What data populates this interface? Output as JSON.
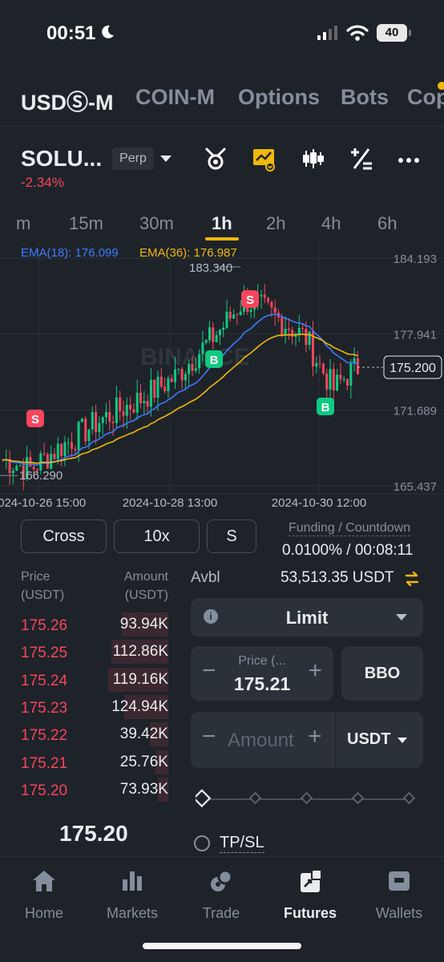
{
  "status_bar": {
    "time": "00:51",
    "battery": "40"
  },
  "market_tabs": [
    "USDⓈ-M",
    "COIN-M",
    "Options",
    "Bots",
    "Cop"
  ],
  "header": {
    "symbol": "SOLU...",
    "contract": "Perp",
    "change": "-2.34%"
  },
  "header_icons": [
    "bot-icon",
    "chart-toggle-icon",
    "candlestick-icon",
    "calculator-icon",
    "more-icon"
  ],
  "intervals": [
    "m",
    "15m",
    "30m",
    "1h",
    "2h",
    "4h",
    "6h"
  ],
  "active_interval": "1h",
  "chart_data": {
    "type": "candlestick",
    "watermark": "BINANCE",
    "indicators": [
      {
        "label": "EMA(18): 176.099",
        "color": "#3d7bfd"
      },
      {
        "label": "EMA(36): 176.987",
        "color": "#f0b90b"
      }
    ],
    "y_ticks": [
      "184.193",
      "177.941",
      "171.689",
      "165.437"
    ],
    "x_ticks": [
      "2024-10-26 15:00",
      "2024-10-28 13:00",
      "2024-10-30 12:00"
    ],
    "ylim": [
      165.437,
      184.193
    ],
    "high_label": "183.340",
    "low_label": "166.290",
    "current_price": "175.200",
    "markers": [
      {
        "label": "S",
        "side": "sell"
      },
      {
        "label": "S",
        "side": "sell"
      },
      {
        "label": "B",
        "side": "buy"
      },
      {
        "label": "B",
        "side": "buy"
      }
    ]
  },
  "controls": {
    "margin_mode": "Cross",
    "leverage": "10x",
    "asset_mode": "S",
    "funding_label": "Funding / Countdown",
    "funding_value": "0.0100% / 00:08:11"
  },
  "order_book": {
    "price_header": "Price\n(USDT)",
    "amount_header": "Amount\n(USDT)",
    "asks": [
      {
        "price": "175.26",
        "amount": "93.94K",
        "depth": 0.45
      },
      {
        "price": "175.25",
        "amount": "112.86K",
        "depth": 0.55
      },
      {
        "price": "175.24",
        "amount": "119.16K",
        "depth": 0.58
      },
      {
        "price": "175.23",
        "amount": "124.94K",
        "depth": 0.42
      },
      {
        "price": "175.22",
        "amount": "39.42K",
        "depth": 0.18
      },
      {
        "price": "175.21",
        "amount": "25.76K",
        "depth": 0.12
      },
      {
        "price": "175.20",
        "amount": "73.93K",
        "depth": 0.1
      }
    ],
    "last_price": "175.20"
  },
  "order_form": {
    "avbl_label": "Avbl",
    "avbl_value": "53,513.35 USDT",
    "order_type": "Limit",
    "price_label": "Price (...",
    "price_value": "175.21",
    "bbo": "BBO",
    "amount_placeholder": "Amount",
    "amount_unit": "USDT",
    "tpsl_label": "TP/SL"
  },
  "bottom_nav": [
    {
      "label": "Home",
      "icon": "home-icon"
    },
    {
      "label": "Markets",
      "icon": "markets-icon"
    },
    {
      "label": "Trade",
      "icon": "trade-icon"
    },
    {
      "label": "Futures",
      "icon": "futures-icon"
    },
    {
      "label": "Wallets",
      "icon": "wallet-icon"
    }
  ],
  "active_nav": "Futures",
  "colors": {
    "up": "#0ecb81",
    "down": "#f6465d",
    "accent": "#f0b90b",
    "bg": "#1e2329"
  }
}
